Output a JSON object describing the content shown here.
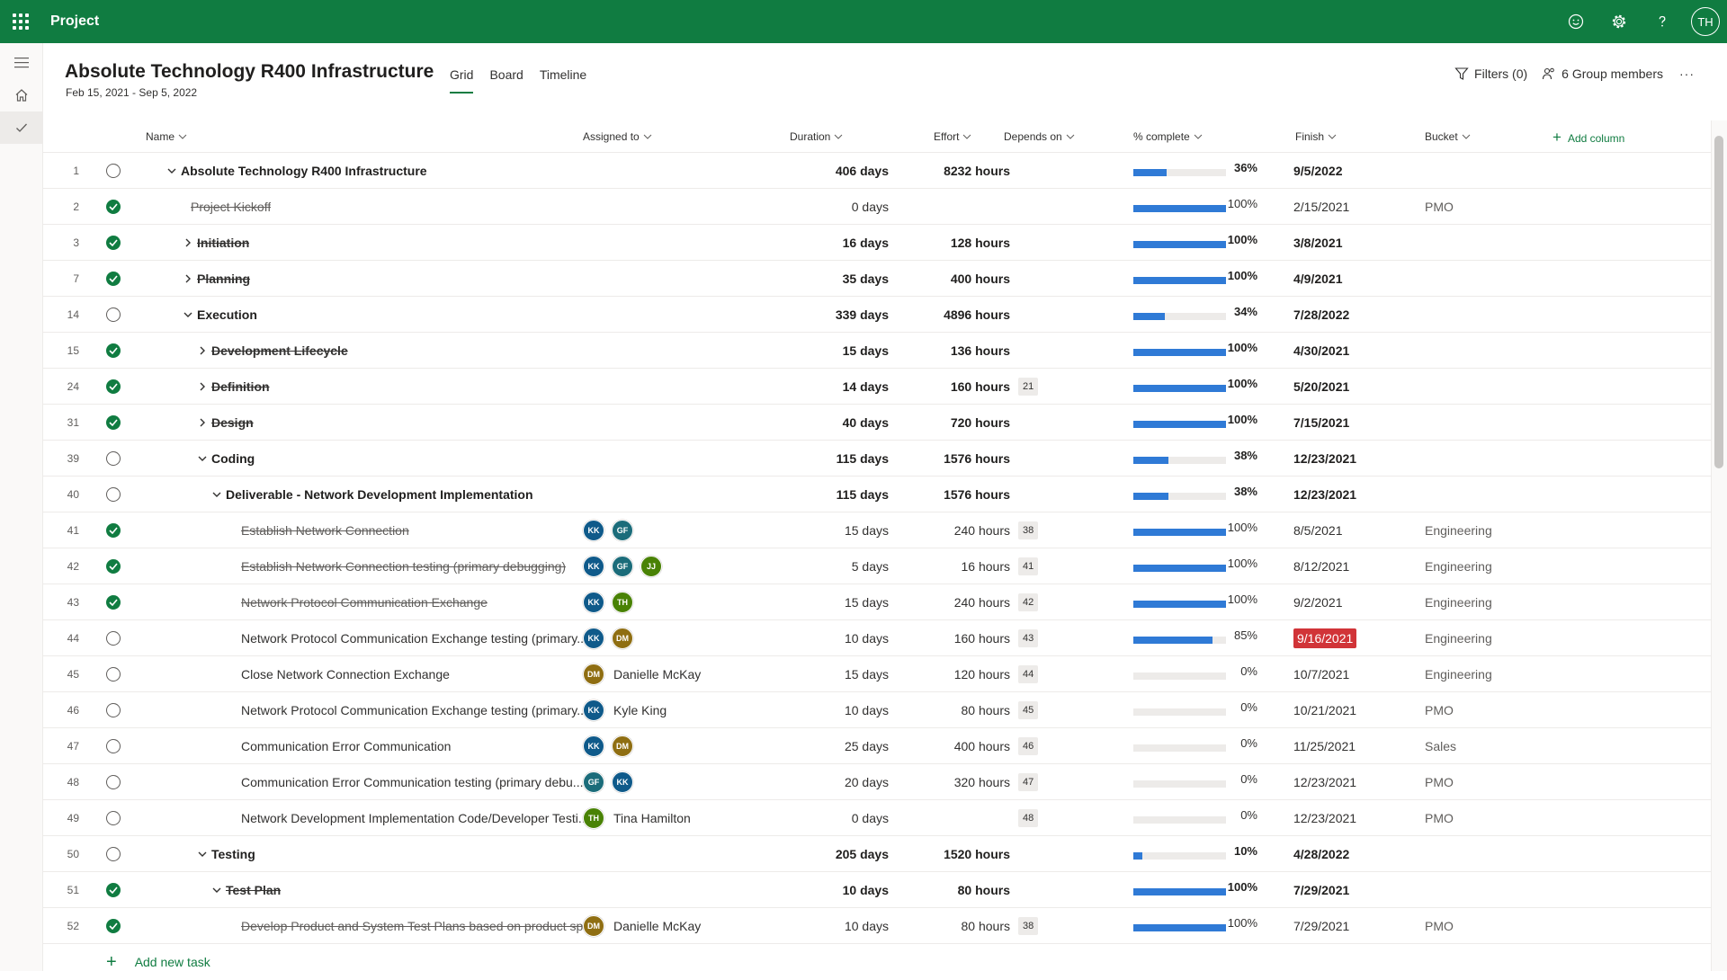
{
  "app": {
    "name": "Project",
    "user_initials": "TH"
  },
  "header": {
    "title": "Absolute Technology R400 Infrastructure",
    "dates": "Feb 15, 2021 - Sep 5, 2022",
    "tabs": [
      "Grid",
      "Board",
      "Timeline"
    ],
    "active_tab": "Grid",
    "filters_label": "Filters (0)",
    "members_label": "6 Group members",
    "more_label": "···"
  },
  "columns": {
    "name": "Name",
    "assigned": "Assigned to",
    "duration": "Duration",
    "effort": "Effort",
    "depends": "Depends on",
    "percent": "% complete",
    "finish": "Finish",
    "bucket": "Bucket",
    "add_column": "Add column"
  },
  "add_task_label": "Add new task",
  "colors": {
    "brand": "#107c41",
    "progress": "#2f7ad6",
    "late": "#d13438"
  },
  "rows": [
    {
      "num": "1",
      "done": false,
      "bold": true,
      "strike": false,
      "indent": 0,
      "caret": "down",
      "name": "Absolute Technology R400 Infrastructure",
      "assignees": [],
      "assignee_name": "",
      "duration": "406 days",
      "effort": "8232 hours",
      "depends": "",
      "percent": 36,
      "percent_label": "36%",
      "finish": "9/5/2022",
      "late": false,
      "bucket": ""
    },
    {
      "num": "2",
      "done": true,
      "bold": false,
      "strike": true,
      "indent": 1,
      "caret": "",
      "name": "Project Kickoff",
      "assignees": [],
      "assignee_name": "",
      "duration": "0 days",
      "effort": "",
      "depends": "",
      "percent": 100,
      "percent_label": "100%",
      "finish": "2/15/2021",
      "late": false,
      "bucket": "PMO"
    },
    {
      "num": "3",
      "done": true,
      "bold": true,
      "strike": true,
      "indent": 1,
      "caret": "right",
      "name": "Initiation",
      "assignees": [],
      "assignee_name": "",
      "duration": "16 days",
      "effort": "128 hours",
      "depends": "",
      "percent": 100,
      "percent_label": "100%",
      "finish": "3/8/2021",
      "late": false,
      "bucket": ""
    },
    {
      "num": "7",
      "done": true,
      "bold": true,
      "strike": true,
      "indent": 1,
      "caret": "right",
      "name": "Planning",
      "assignees": [],
      "assignee_name": "",
      "duration": "35 days",
      "effort": "400 hours",
      "depends": "",
      "percent": 100,
      "percent_label": "100%",
      "finish": "4/9/2021",
      "late": false,
      "bucket": ""
    },
    {
      "num": "14",
      "done": false,
      "bold": true,
      "strike": false,
      "indent": 1,
      "caret": "down",
      "name": "Execution",
      "assignees": [],
      "assignee_name": "",
      "duration": "339 days",
      "effort": "4896 hours",
      "depends": "",
      "percent": 34,
      "percent_label": "34%",
      "finish": "7/28/2022",
      "late": false,
      "bucket": ""
    },
    {
      "num": "15",
      "done": true,
      "bold": true,
      "strike": true,
      "indent": 2,
      "caret": "right",
      "name": "Development Lifecycle",
      "assignees": [],
      "assignee_name": "",
      "duration": "15 days",
      "effort": "136 hours",
      "depends": "",
      "percent": 100,
      "percent_label": "100%",
      "finish": "4/30/2021",
      "late": false,
      "bucket": ""
    },
    {
      "num": "24",
      "done": true,
      "bold": true,
      "strike": true,
      "indent": 2,
      "caret": "right",
      "name": "Definition",
      "assignees": [],
      "assignee_name": "",
      "duration": "14 days",
      "effort": "160 hours",
      "depends": "21",
      "percent": 100,
      "percent_label": "100%",
      "finish": "5/20/2021",
      "late": false,
      "bucket": ""
    },
    {
      "num": "31",
      "done": true,
      "bold": true,
      "strike": true,
      "indent": 2,
      "caret": "right",
      "name": "Design",
      "assignees": [],
      "assignee_name": "",
      "duration": "40 days",
      "effort": "720 hours",
      "depends": "",
      "percent": 100,
      "percent_label": "100%",
      "finish": "7/15/2021",
      "late": false,
      "bucket": ""
    },
    {
      "num": "39",
      "done": false,
      "bold": true,
      "strike": false,
      "indent": 2,
      "caret": "down",
      "name": "Coding",
      "assignees": [],
      "assignee_name": "",
      "duration": "115 days",
      "effort": "1576 hours",
      "depends": "",
      "percent": 38,
      "percent_label": "38%",
      "finish": "12/23/2021",
      "late": false,
      "bucket": ""
    },
    {
      "num": "40",
      "done": false,
      "bold": true,
      "strike": false,
      "indent": 3,
      "caret": "down",
      "name": "Deliverable - Network Development Implementation",
      "assignees": [],
      "assignee_name": "",
      "duration": "115 days",
      "effort": "1576 hours",
      "depends": "",
      "percent": 38,
      "percent_label": "38%",
      "finish": "12/23/2021",
      "late": false,
      "bucket": ""
    },
    {
      "num": "41",
      "done": true,
      "bold": false,
      "strike": true,
      "indent": 4,
      "caret": "",
      "name": "Establish Network Connection",
      "assignees": [
        {
          "i": "KK",
          "c": "#0f5a8a"
        },
        {
          "i": "GF",
          "c": "#1b6c7a"
        }
      ],
      "assignee_name": "",
      "duration": "15 days",
      "effort": "240 hours",
      "depends": "38",
      "percent": 100,
      "percent_label": "100%",
      "finish": "8/5/2021",
      "late": false,
      "bucket": "Engineering"
    },
    {
      "num": "42",
      "done": true,
      "bold": false,
      "strike": true,
      "indent": 4,
      "caret": "",
      "name": "Establish Network Connection testing (primary debugging)",
      "assignees": [
        {
          "i": "KK",
          "c": "#0f5a8a"
        },
        {
          "i": "GF",
          "c": "#1b6c7a"
        },
        {
          "i": "JJ",
          "c": "#498205"
        }
      ],
      "assignee_name": "",
      "duration": "5 days",
      "effort": "16 hours",
      "depends": "41",
      "percent": 100,
      "percent_label": "100%",
      "finish": "8/12/2021",
      "late": false,
      "bucket": "Engineering"
    },
    {
      "num": "43",
      "done": true,
      "bold": false,
      "strike": true,
      "indent": 4,
      "caret": "",
      "name": "Network Protocol Communication Exchange",
      "assignees": [
        {
          "i": "KK",
          "c": "#0f5a8a"
        },
        {
          "i": "TH",
          "c": "#498205"
        }
      ],
      "assignee_name": "",
      "duration": "15 days",
      "effort": "240 hours",
      "depends": "42",
      "percent": 100,
      "percent_label": "100%",
      "finish": "9/2/2021",
      "late": false,
      "bucket": "Engineering"
    },
    {
      "num": "44",
      "done": false,
      "bold": false,
      "strike": false,
      "indent": 4,
      "caret": "",
      "name": "Network Protocol Communication Exchange testing (primary...",
      "assignees": [
        {
          "i": "KK",
          "c": "#0f5a8a"
        },
        {
          "i": "DM",
          "c": "#8f6e12"
        }
      ],
      "assignee_name": "",
      "duration": "10 days",
      "effort": "160 hours",
      "depends": "43",
      "percent": 85,
      "percent_label": "85%",
      "finish": "9/16/2021",
      "late": true,
      "bucket": "Engineering"
    },
    {
      "num": "45",
      "done": false,
      "bold": false,
      "strike": false,
      "indent": 4,
      "caret": "",
      "name": "Close Network Connection Exchange",
      "assignees": [
        {
          "i": "DM",
          "c": "#8f6e12"
        }
      ],
      "assignee_name": "Danielle McKay",
      "duration": "15 days",
      "effort": "120 hours",
      "depends": "44",
      "percent": 0,
      "percent_label": "0%",
      "finish": "10/7/2021",
      "late": false,
      "bucket": "Engineering"
    },
    {
      "num": "46",
      "done": false,
      "bold": false,
      "strike": false,
      "indent": 4,
      "caret": "",
      "name": "Network Protocol Communication Exchange testing (primary...",
      "assignees": [
        {
          "i": "KK",
          "c": "#0f5a8a"
        }
      ],
      "assignee_name": "Kyle King",
      "duration": "10 days",
      "effort": "80 hours",
      "depends": "45",
      "percent": 0,
      "percent_label": "0%",
      "finish": "10/21/2021",
      "late": false,
      "bucket": "PMO"
    },
    {
      "num": "47",
      "done": false,
      "bold": false,
      "strike": false,
      "indent": 4,
      "caret": "",
      "name": "Communication Error Communication",
      "assignees": [
        {
          "i": "KK",
          "c": "#0f5a8a"
        },
        {
          "i": "DM",
          "c": "#8f6e12"
        }
      ],
      "assignee_name": "",
      "duration": "25 days",
      "effort": "400 hours",
      "depends": "46",
      "percent": 0,
      "percent_label": "0%",
      "finish": "11/25/2021",
      "late": false,
      "bucket": "Sales"
    },
    {
      "num": "48",
      "done": false,
      "bold": false,
      "strike": false,
      "indent": 4,
      "caret": "",
      "name": "Communication Error Communication testing (primary debu...",
      "assignees": [
        {
          "i": "GF",
          "c": "#1b6c7a"
        },
        {
          "i": "KK",
          "c": "#0f5a8a"
        }
      ],
      "assignee_name": "",
      "duration": "20 days",
      "effort": "320 hours",
      "depends": "47",
      "percent": 0,
      "percent_label": "0%",
      "finish": "12/23/2021",
      "late": false,
      "bucket": "PMO"
    },
    {
      "num": "49",
      "done": false,
      "bold": false,
      "strike": false,
      "indent": 4,
      "caret": "",
      "name": "Network Development Implementation Code/Developer Testi...",
      "assignees": [
        {
          "i": "TH",
          "c": "#498205"
        }
      ],
      "assignee_name": "Tina Hamilton",
      "duration": "0 days",
      "effort": "",
      "depends": "48",
      "percent": 0,
      "percent_label": "0%",
      "finish": "12/23/2021",
      "late": false,
      "bucket": "PMO"
    },
    {
      "num": "50",
      "done": false,
      "bold": true,
      "strike": false,
      "indent": 2,
      "caret": "down",
      "name": "Testing",
      "assignees": [],
      "assignee_name": "",
      "duration": "205 days",
      "effort": "1520 hours",
      "depends": "",
      "percent": 10,
      "percent_label": "10%",
      "finish": "4/28/2022",
      "late": false,
      "bucket": ""
    },
    {
      "num": "51",
      "done": true,
      "bold": true,
      "strike": true,
      "indent": 3,
      "caret": "down",
      "name": "Test Plan",
      "assignees": [],
      "assignee_name": "",
      "duration": "10 days",
      "effort": "80 hours",
      "depends": "",
      "percent": 100,
      "percent_label": "100%",
      "finish": "7/29/2021",
      "late": false,
      "bucket": ""
    },
    {
      "num": "52",
      "done": true,
      "bold": false,
      "strike": true,
      "indent": 4,
      "caret": "",
      "name": "Develop Product and System Test Plans based on product sp...",
      "assignees": [
        {
          "i": "DM",
          "c": "#8f6e12"
        }
      ],
      "assignee_name": "Danielle McKay",
      "duration": "10 days",
      "effort": "80 hours",
      "depends": "38",
      "percent": 100,
      "percent_label": "100%",
      "finish": "7/29/2021",
      "late": false,
      "bucket": "PMO"
    }
  ]
}
